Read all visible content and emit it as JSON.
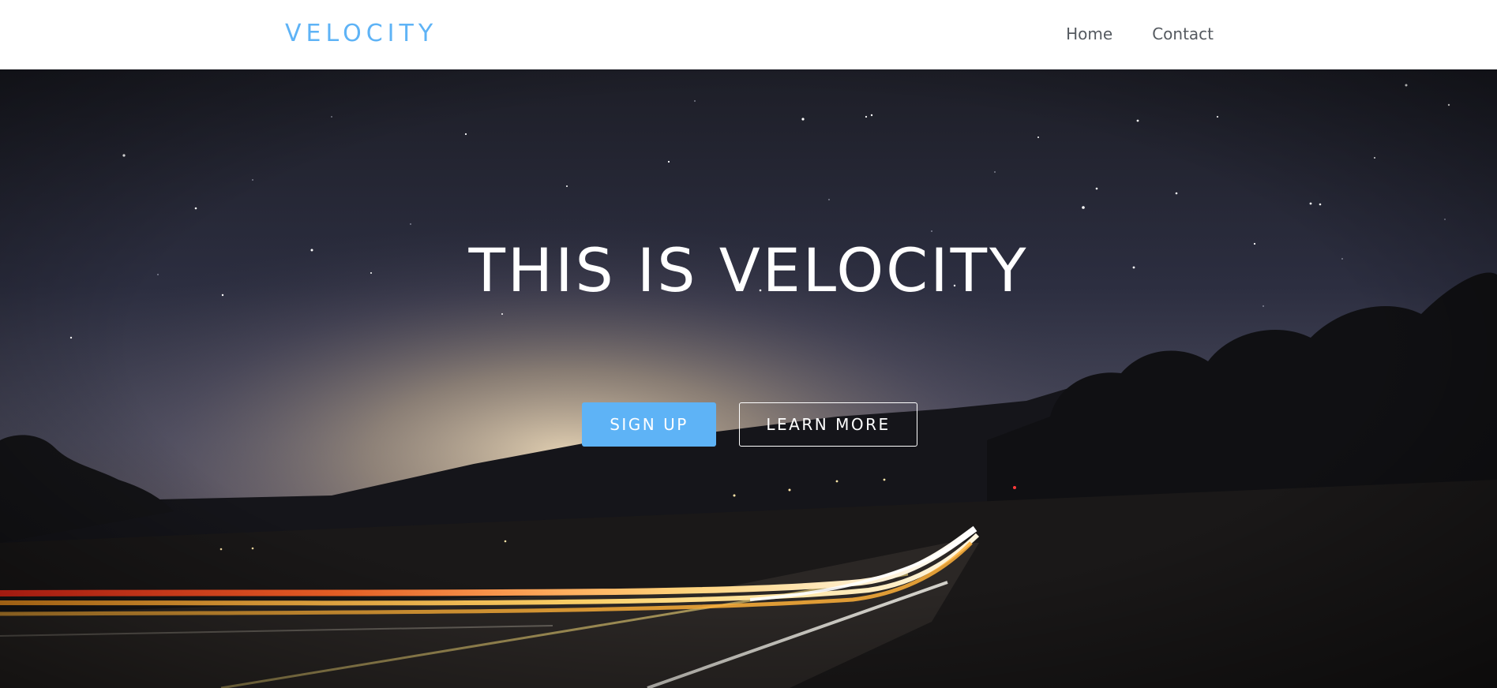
{
  "header": {
    "brand": "VELOCITY",
    "nav": [
      {
        "label": "Home"
      },
      {
        "label": "Contact"
      }
    ]
  },
  "hero": {
    "title": "THIS IS VELOCITY",
    "signup_label": "SIGN UP",
    "learn_more_label": "LEARN MORE",
    "background": "night-sky-highway-light-trails-photo"
  },
  "colors": {
    "accent": "#5eb3f6",
    "nav_text": "#555a60",
    "header_bg": "#ffffff"
  }
}
